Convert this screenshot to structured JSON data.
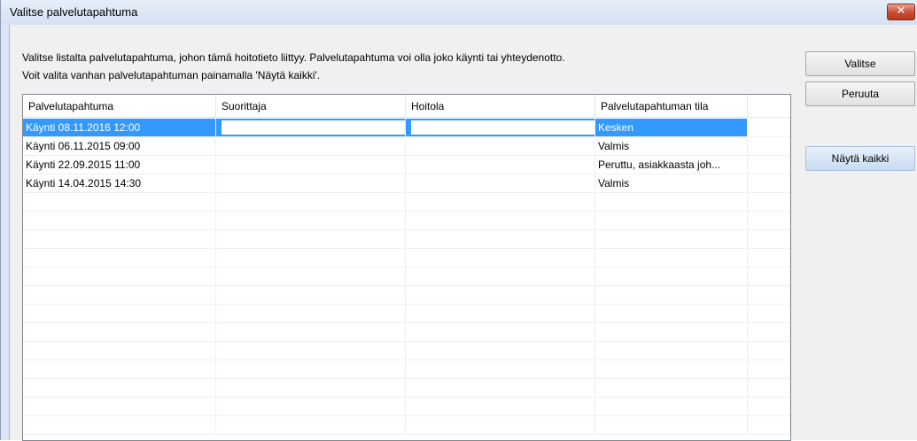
{
  "window": {
    "title": "Valitse palvelutapahtuma",
    "close_glyph": "✕"
  },
  "description": {
    "line1": "Valitse listalta palvelutapahtuma, johon tämä hoitotieto liittyy. Palvelutapahtuma voi olla joko käynti tai yhteydenotto.",
    "line2": "Voit valita vanhan palvelutapahtuman painamalla 'Näytä kaikki'."
  },
  "table": {
    "columns": [
      "Palvelutapahtuma",
      "Suorittaja",
      "Hoitola",
      "Palvelutapahtuman tila"
    ],
    "rows": [
      {
        "event": "Käynti  08.11.2016  12:00",
        "performer": "",
        "clinic": "",
        "status": "Kesken",
        "selected": true
      },
      {
        "event": "Käynti  06.11.2015  09:00",
        "performer": "",
        "clinic": "",
        "status": "Valmis",
        "selected": false
      },
      {
        "event": "Käynti  22.09.2015  11:00",
        "performer": "",
        "clinic": "",
        "status": "Peruttu, asiakkaasta joh...",
        "selected": false
      },
      {
        "event": "Käynti  14.04.2015  14:30",
        "performer": "",
        "clinic": "",
        "status": "Valmis",
        "selected": false
      }
    ]
  },
  "buttons": {
    "select_label": "Valitse",
    "cancel_label": "Peruuta",
    "show_all_label": "Näytä kaikki"
  },
  "colors": {
    "selection": "#3399ff",
    "dialog_frame": "#dbe7f6",
    "close_button": "#c74a32"
  },
  "icons": {
    "close": "close-icon"
  }
}
